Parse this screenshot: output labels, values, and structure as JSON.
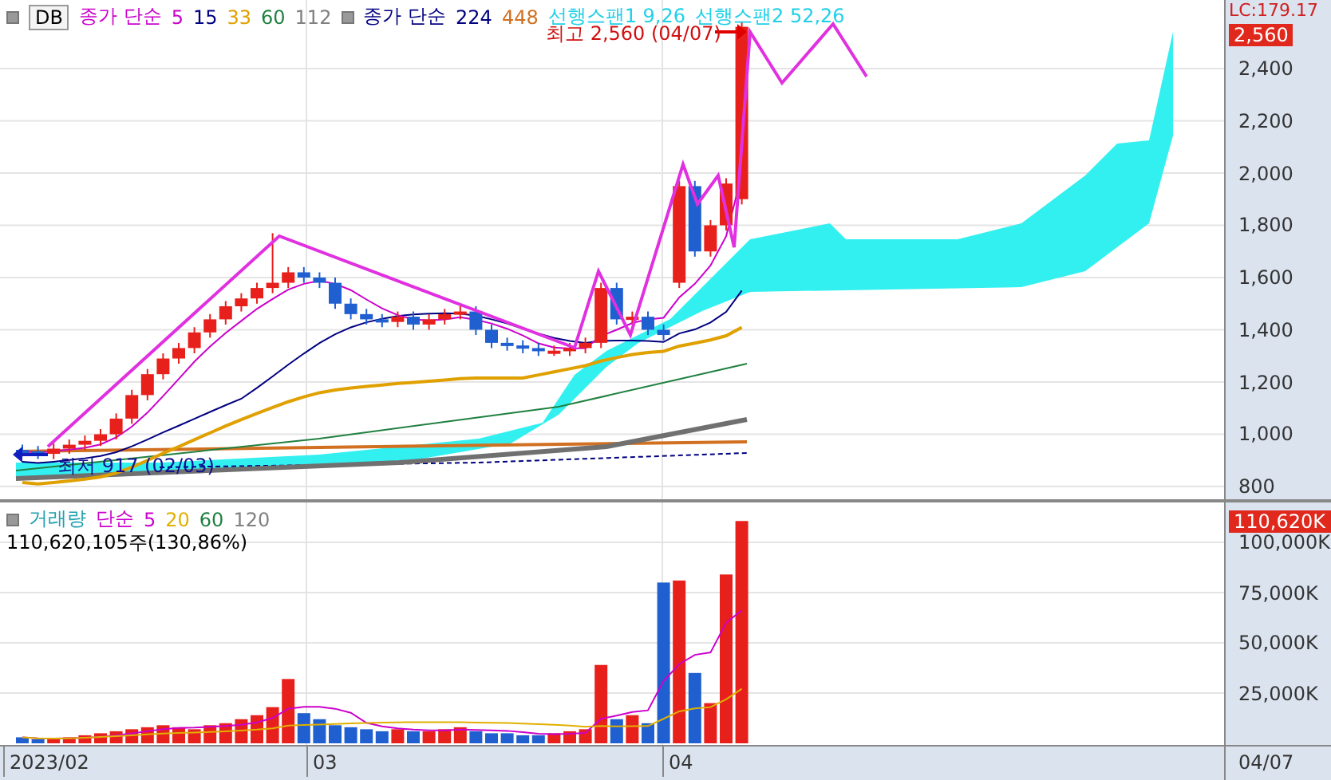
{
  "price_pane": {
    "db_label": "DB",
    "legend_groups": [
      {
        "items": [
          {
            "text": "종가 단순",
            "color": "#cc00cc"
          },
          {
            "text": "5",
            "color": "#cc00cc"
          },
          {
            "text": "15",
            "color": "#000080"
          },
          {
            "text": "33",
            "color": "#e0a000"
          },
          {
            "text": "60",
            "color": "#208040"
          },
          {
            "text": "112",
            "color": "#808080"
          }
        ]
      },
      {
        "items": [
          {
            "text": "종가 단순",
            "color": "#000080"
          },
          {
            "text": "224",
            "color": "#000080"
          },
          {
            "text": "448",
            "color": "#d07020"
          },
          {
            "text": "선행스팬1 9,26",
            "color": "#20d0e8"
          },
          {
            "text": "선행스팬2 52,26",
            "color": "#20d0e8"
          }
        ]
      }
    ],
    "high_marker": "최고 2,560 (04/07)",
    "low_marker": "최저 917 (02/03)",
    "axis": {
      "corner": "LC:179.17",
      "current": "2,560",
      "ticks": [
        "2,400",
        "2,200",
        "2,000",
        "1,800",
        "1,600",
        "1,400",
        "1,200",
        "1,000",
        "800"
      ]
    }
  },
  "volume_pane": {
    "title": "거래량",
    "legend": [
      {
        "text": "단순",
        "color": "#cc00cc"
      },
      {
        "text": "5",
        "color": "#cc00cc"
      },
      {
        "text": "20",
        "color": "#e0b000"
      },
      {
        "text": "60",
        "color": "#208040"
      },
      {
        "text": "120",
        "color": "#808080"
      }
    ],
    "total": "110,620,105주(130,86%)",
    "axis": {
      "current": "110,620K",
      "ticks": [
        "100,000K",
        "75,000K",
        "50,000K",
        "25,000K"
      ]
    }
  },
  "x_axis": {
    "labels": [
      "2023/02",
      "03",
      "04"
    ],
    "current": "04/07"
  }
}
